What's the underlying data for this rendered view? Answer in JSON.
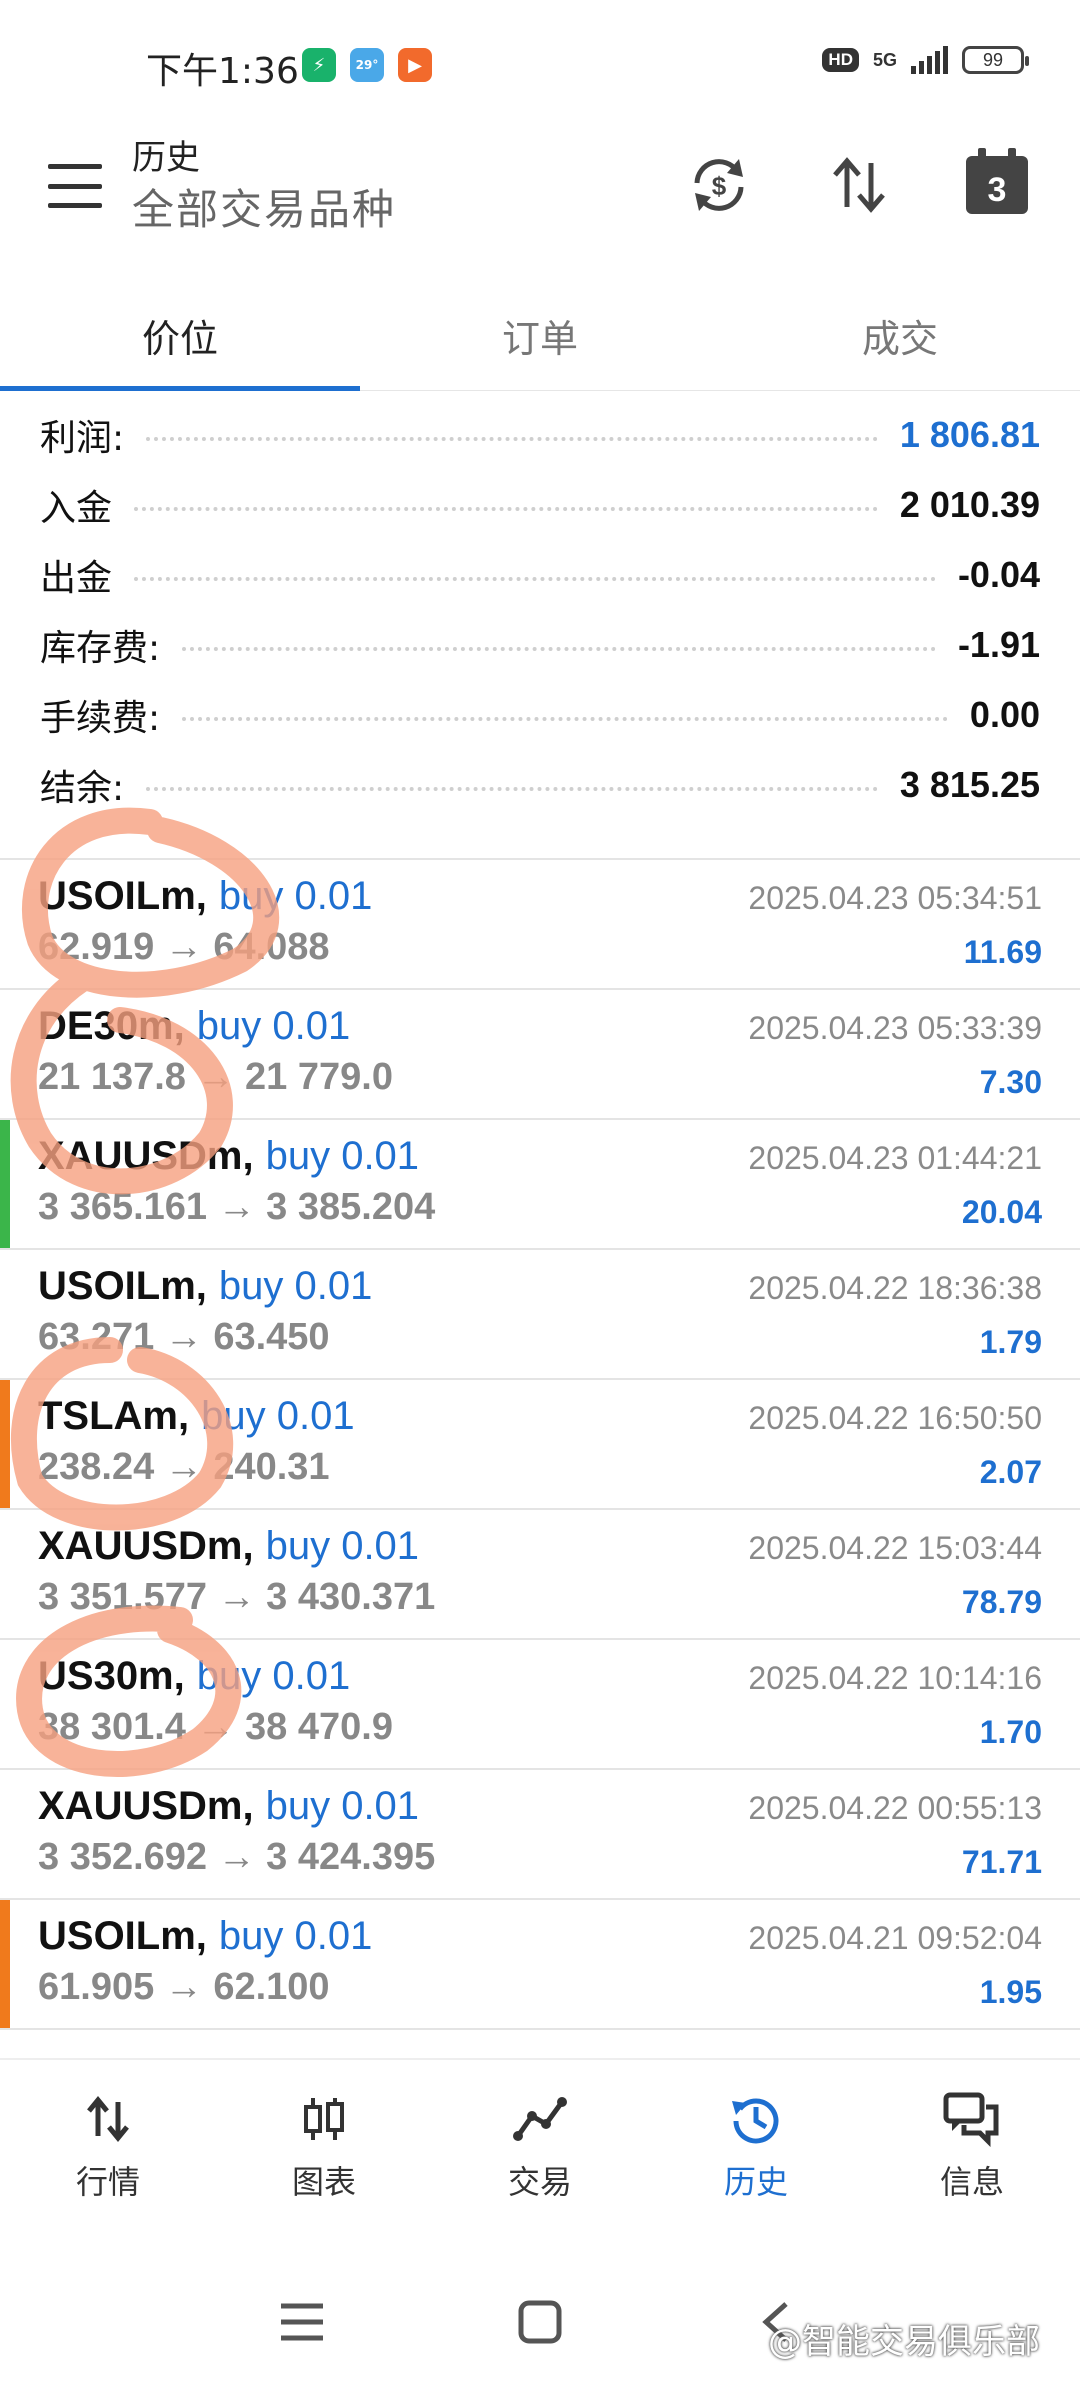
{
  "status_bar": {
    "time": "下午1:36",
    "network": "5G",
    "hd": "HD",
    "battery": "99",
    "app_icons": [
      "shield-app-icon",
      "weather-app-icon",
      "video-app-icon"
    ],
    "weather_temp": "29°"
  },
  "toolbar": {
    "title": "历史",
    "subtitle": "全部交易品种",
    "calendar_day": "3"
  },
  "tabs": [
    {
      "label": "价位",
      "active": true
    },
    {
      "label": "订单",
      "active": false
    },
    {
      "label": "成交",
      "active": false
    }
  ],
  "summary": [
    {
      "label": "利润:",
      "value": "1 806.81",
      "highlight": true
    },
    {
      "label": "入金",
      "value": "2 010.39",
      "highlight": false
    },
    {
      "label": "出金",
      "value": "-0.04",
      "highlight": false
    },
    {
      "label": "库存费:",
      "value": "-1.91",
      "highlight": false
    },
    {
      "label": "手续费:",
      "value": "0.00",
      "highlight": false
    },
    {
      "label": "结余:",
      "value": "3 815.25",
      "highlight": false
    }
  ],
  "deals": [
    {
      "symbol": "USOILm,",
      "side": "buy 0.01",
      "prices": "62.919 → 64.088",
      "time": "2025.04.23 05:34:51",
      "profit": "11.69",
      "marker": ""
    },
    {
      "symbol": "DE30m,",
      "side": "buy 0.01",
      "prices": "21 137.8 → 21 779.0",
      "time": "2025.04.23 05:33:39",
      "profit": "7.30",
      "marker": ""
    },
    {
      "symbol": "XAUUSDm,",
      "side": "buy 0.01",
      "prices": "3 365.161 → 3 385.204",
      "time": "2025.04.23 01:44:21",
      "profit": "20.04",
      "marker": "#3bb54a"
    },
    {
      "symbol": "USOILm,",
      "side": "buy 0.01",
      "prices": "63.271 → 63.450",
      "time": "2025.04.22 18:36:38",
      "profit": "1.79",
      "marker": ""
    },
    {
      "symbol": "TSLAm,",
      "side": "buy 0.01",
      "prices": "238.24 → 240.31",
      "time": "2025.04.22 16:50:50",
      "profit": "2.07",
      "marker": "#f07a1c"
    },
    {
      "symbol": "XAUUSDm,",
      "side": "buy 0.01",
      "prices": "3 351.577 → 3 430.371",
      "time": "2025.04.22 15:03:44",
      "profit": "78.79",
      "marker": ""
    },
    {
      "symbol": "US30m,",
      "side": "buy 0.01",
      "prices": "38 301.4 → 38 470.9",
      "time": "2025.04.22 10:14:16",
      "profit": "1.70",
      "marker": ""
    },
    {
      "symbol": "XAUUSDm,",
      "side": "buy 0.01",
      "prices": "3 352.692 → 3 424.395",
      "time": "2025.04.22 00:55:13",
      "profit": "71.71",
      "marker": ""
    },
    {
      "symbol": "USOILm,",
      "side": "buy 0.01",
      "prices": "61.905 → 62.100",
      "time": "2025.04.21 09:52:04",
      "profit": "1.95",
      "marker": "#f07a1c"
    }
  ],
  "bottom_nav": [
    {
      "label": "行情",
      "icon": "quotes-icon",
      "active": false
    },
    {
      "label": "图表",
      "icon": "chart-candles-icon",
      "active": false
    },
    {
      "label": "交易",
      "icon": "trade-icon",
      "active": false
    },
    {
      "label": "历史",
      "icon": "history-icon",
      "active": true
    },
    {
      "label": "信息",
      "icon": "messages-icon",
      "active": false
    }
  ],
  "watermark": "@智能交易俱乐部",
  "colors": {
    "accent": "#1e6fd0",
    "annotation": "#f6a07f",
    "marker_green": "#3bb54a",
    "marker_orange": "#f07a1c"
  }
}
